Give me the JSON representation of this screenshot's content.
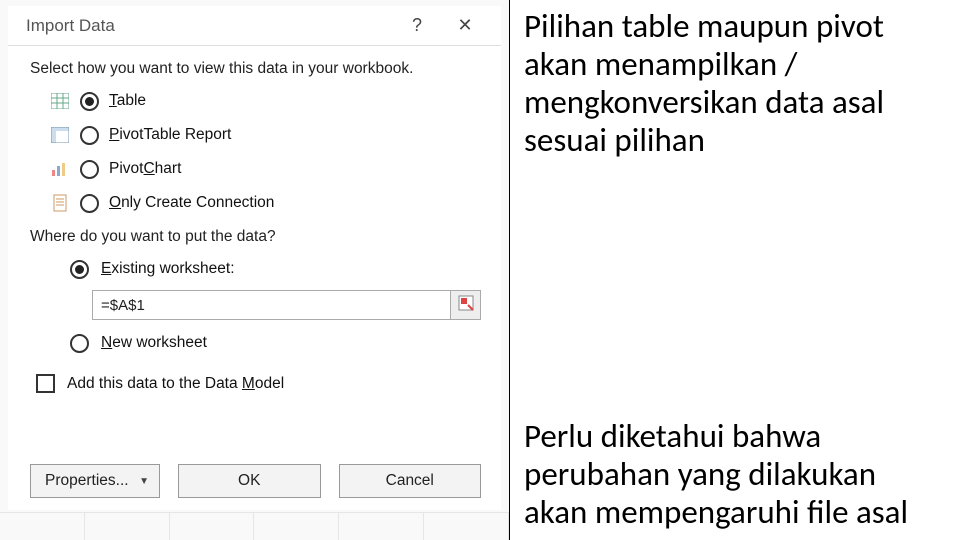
{
  "dialog": {
    "title": "Import Data",
    "help_glyph": "?",
    "close_glyph": "✕",
    "section1_label": "Select how you want to view this data in your workbook.",
    "options": {
      "table": {
        "label_pre": "",
        "label_ul": "T",
        "label_post": "able"
      },
      "pivot_table": {
        "label_pre": "",
        "label_ul": "P",
        "label_post": "ivotTable Report"
      },
      "pivot_chart": {
        "label_pre": "Pivot",
        "label_ul": "C",
        "label_post": "hart"
      },
      "only_conn": {
        "label_pre": "",
        "label_ul": "O",
        "label_post": "nly Create Connection"
      }
    },
    "section2_label": "Where do you want to put the data?",
    "placement": {
      "existing": {
        "label_pre": "",
        "label_ul": "E",
        "label_post": "xisting worksheet:"
      },
      "cell_ref": "=$A$1",
      "new_ws": {
        "label_pre": "",
        "label_ul": "N",
        "label_post": "ew worksheet"
      }
    },
    "datamodel": {
      "label_pre": "Add this data to the Data ",
      "label_ul": "M",
      "label_post": "odel"
    },
    "buttons": {
      "properties": "Properties...",
      "ok": "OK",
      "cancel": "Cancel"
    }
  },
  "notes": {
    "p1": "Pilihan table maupun pivot akan menampilkan / mengkonversikan data asal sesuai pilihan",
    "p2": "Perlu diketahui bahwa perubahan yang dilakukan akan mempengaruhi file asal"
  }
}
